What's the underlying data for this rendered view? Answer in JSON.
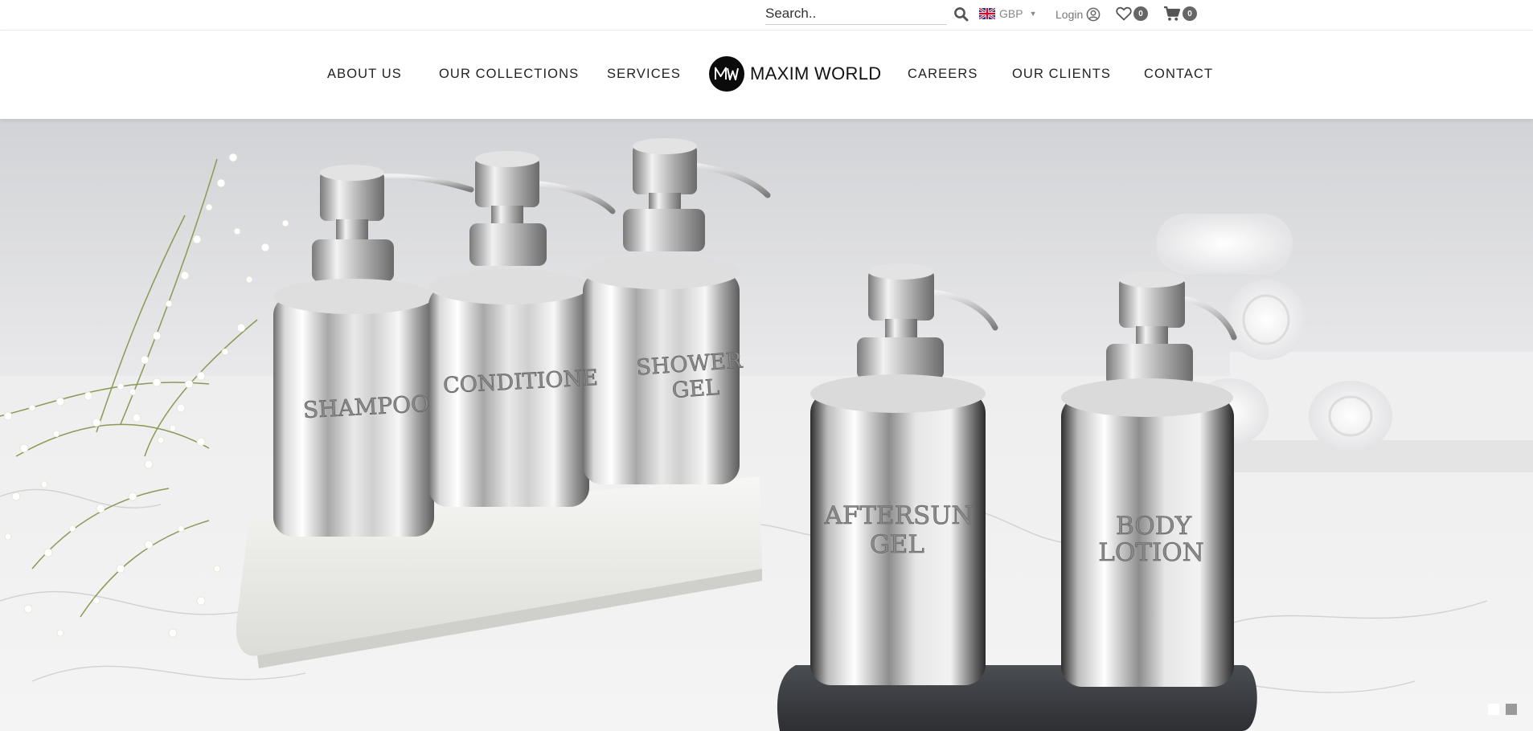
{
  "topbar": {
    "search": {
      "placeholder": "Search..",
      "value": ""
    },
    "search_icon": "search-icon",
    "currency": {
      "code": "GBP",
      "flag": "uk-flag-icon"
    },
    "login_label": "Login",
    "wishlist_count": "0",
    "cart_count": "0"
  },
  "nav": {
    "left": [
      "ABOUT US",
      "OUR COLLECTIONS",
      "SERVICES"
    ],
    "logo_text": "MAXIM WORLD",
    "right": [
      "CAREERS",
      "OUR CLIENTS",
      "CONTACT"
    ]
  },
  "hero": {
    "bottle_labels": {
      "shampoo": "SHAMPOO",
      "conditioner": "CONDITIONE",
      "shower_gel": [
        "SHOWER",
        "GEL"
      ],
      "aftersun_gel": [
        "AFTERSUN",
        "GEL"
      ],
      "body_lotion": [
        "BODY",
        "LOTION"
      ]
    },
    "slides": 2,
    "active_slide": 1
  },
  "colors": {
    "badge": "#666666",
    "text": "#222222",
    "muted": "#888888"
  }
}
